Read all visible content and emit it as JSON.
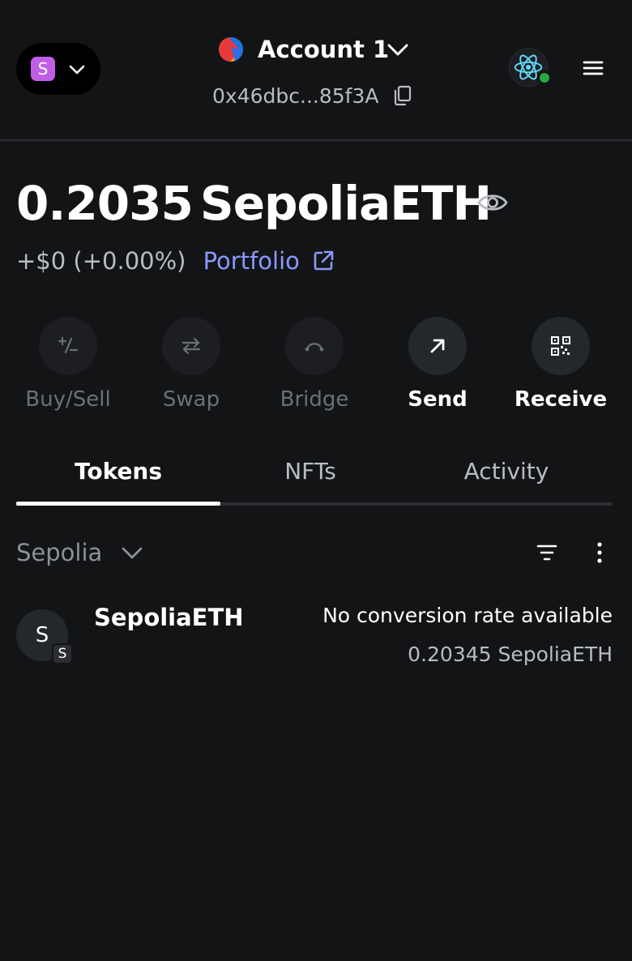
{
  "header": {
    "network": {
      "initial": "S",
      "color": "#c15ee6",
      "icon": "chevron-down-icon"
    },
    "account": {
      "name": "Account 1",
      "address": "0x46dbc...85f3A",
      "avatar": "account-avatar"
    },
    "connected_status_color": "#28a745",
    "icons": {
      "copy": "copy-icon",
      "menu": "menu-icon",
      "connected_site": "react-atom-icon"
    }
  },
  "balance": {
    "value": "0.2035",
    "unit": "SepoliaETH",
    "change": "+$0 (+0.00%)",
    "portfolio_label": "Portfolio",
    "accent_color": "#8b99ff"
  },
  "actions": [
    {
      "label": "Buy/Sell",
      "icon": "plus-minus-icon",
      "enabled": false
    },
    {
      "label": "Swap",
      "icon": "swap-arrows-icon",
      "enabled": false
    },
    {
      "label": "Bridge",
      "icon": "bridge-icon",
      "enabled": false
    },
    {
      "label": "Send",
      "icon": "arrow-up-right-icon",
      "enabled": true
    },
    {
      "label": "Receive",
      "icon": "qr-code-icon",
      "enabled": true
    }
  ],
  "tabs": [
    {
      "label": "Tokens",
      "active": true
    },
    {
      "label": "NFTs",
      "active": false
    },
    {
      "label": "Activity",
      "active": false
    }
  ],
  "filter": {
    "network_label": "Sepolia"
  },
  "tokens": [
    {
      "initial": "S",
      "badge": "S",
      "name": "SepoliaETH",
      "fiat": "No conversion rate available",
      "balance": "0.20345 SepoliaETH"
    }
  ]
}
